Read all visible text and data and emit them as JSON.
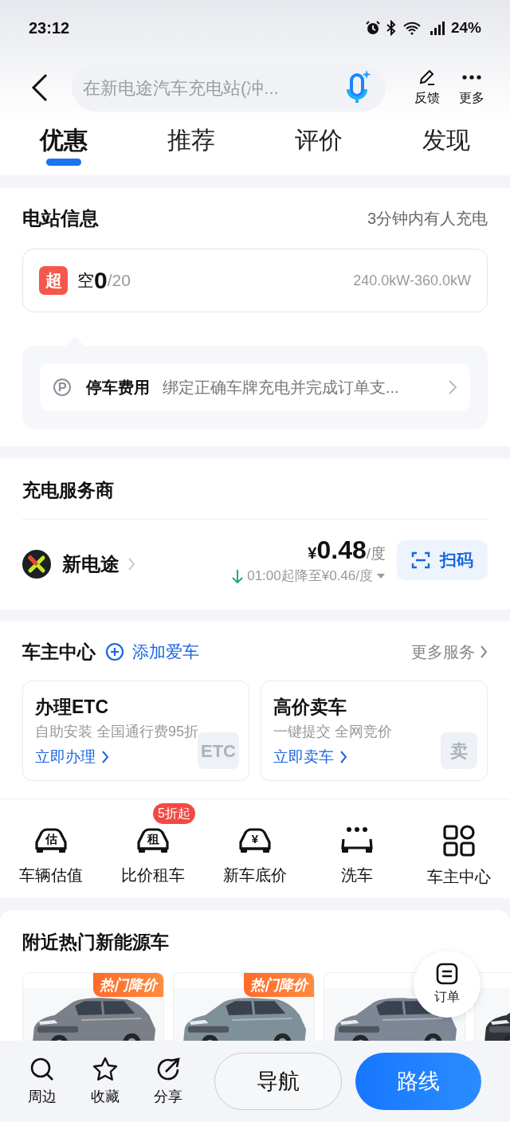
{
  "status_bar": {
    "time": "23:12",
    "battery": "24%"
  },
  "header": {
    "search": {
      "placeholder": "在新电途汽车充电站(冲..."
    },
    "actions": [
      {
        "kind": "feedback",
        "label": "反馈"
      },
      {
        "kind": "more",
        "label": "更多"
      }
    ]
  },
  "tabs": [
    {
      "label": "优惠",
      "selected": true
    },
    {
      "label": "推荐",
      "selected": false
    },
    {
      "label": "评价",
      "selected": false
    },
    {
      "label": "发现",
      "selected": false
    }
  ],
  "station_info": {
    "title": "电站信息",
    "note": "3分钟内有人充电",
    "charger": {
      "badge": "超",
      "free_label": "空",
      "free": "0",
      "total": "/20",
      "power": "240.0kW-360.0kW"
    },
    "parking": {
      "label": "停车费用",
      "text": "绑定正确车牌充电并完成订单支..."
    }
  },
  "provider_section": {
    "title": "充电服务商",
    "provider": {
      "name": "新电途",
      "price_symbol": "¥",
      "price": "0.48",
      "unit": "/度",
      "discount": "01:00起降至¥0.46/度",
      "button": "扫码"
    }
  },
  "owner_center": {
    "title": "车主中心",
    "add_car": "添加爱车",
    "more": "更多服务",
    "cards": [
      {
        "title": "办理ETC",
        "subtitle": "自助安装 全国通行费95折",
        "link": "立即办理",
        "emblem": "ETC"
      },
      {
        "title": "高价卖车",
        "subtitle": "一键提交 全网竞价",
        "link": "立即卖车",
        "emblem": "卖"
      }
    ]
  },
  "services": [
    {
      "kind": "car",
      "glyph": "估",
      "label": "车辆估值"
    },
    {
      "kind": "car",
      "glyph": "租",
      "label": "比价租车",
      "badge": "5折起"
    },
    {
      "kind": "car",
      "glyph": "¥",
      "label": "新车底价"
    },
    {
      "kind": "wash",
      "label": "洗车"
    },
    {
      "kind": "grid",
      "label": "车主中心"
    }
  ],
  "nearby": {
    "title": "附近热门新能源车",
    "cars": [
      {
        "kind": "picture",
        "tag": "热门降价"
      },
      {
        "kind": "picture",
        "tag": "热门降价"
      },
      {
        "kind": "picture"
      },
      {
        "kind": "picture"
      }
    ]
  },
  "order_button": {
    "label": "订单"
  },
  "bottom_bar": {
    "actions": [
      {
        "kind": "search",
        "label": "周边"
      },
      {
        "kind": "star",
        "label": "收藏"
      },
      {
        "kind": "share",
        "label": "分享"
      }
    ],
    "navigate": "导航",
    "route": "路线"
  }
}
